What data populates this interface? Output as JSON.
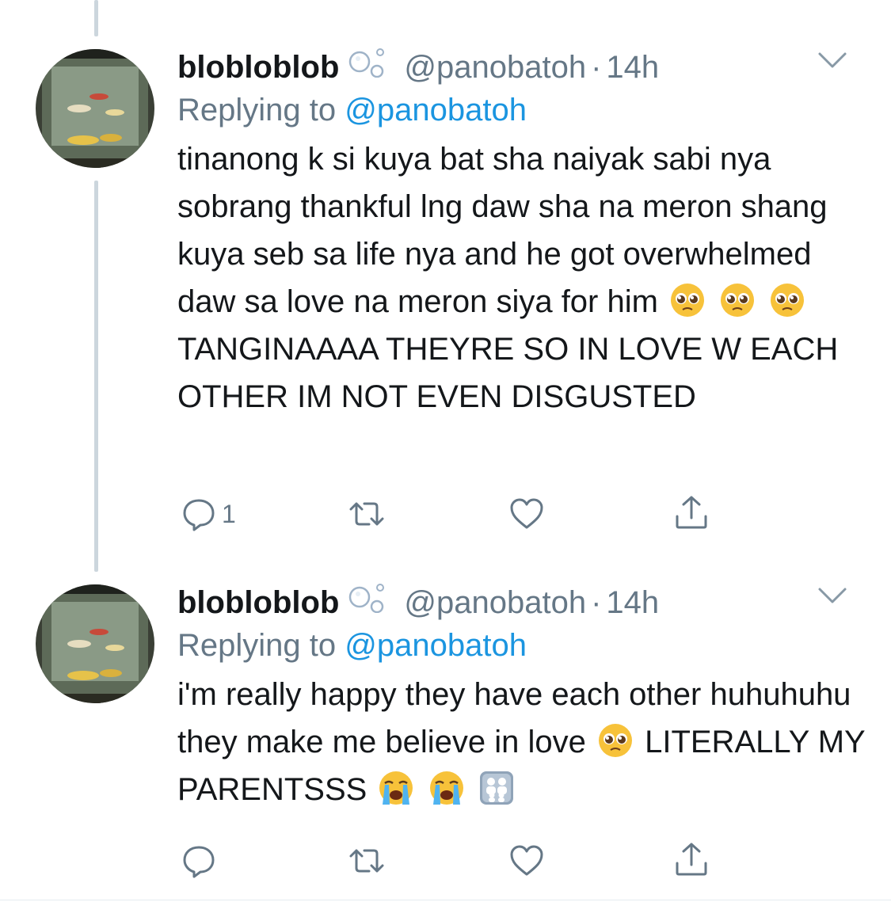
{
  "tweets": [
    {
      "name": "blobloblob",
      "handle": "@panobatoh",
      "separator": "·",
      "time": "14h",
      "replying_prefix": "Replying to",
      "replying_handle": "@panobatoh",
      "text_plain_1": "tinanong k si kuya bat sha naiyak sabi nya sobrang thankful lng daw sha na meron shang kuya seb sa life nya and he got overwhelmed daw sa love na meron siya for him",
      "text_plain_2": "TANGINAAAA THEYRE SO IN LOVE W EACH OTHER IM NOT EVEN DISGUSTED",
      "emojis": [
        "pleading-face",
        "pleading-face",
        "pleading-face"
      ],
      "reply_count": "1"
    },
    {
      "name": "blobloblob",
      "handle": "@panobatoh",
      "separator": "·",
      "time": "14h",
      "replying_prefix": "Replying to",
      "replying_handle": "@panobatoh",
      "text_plain_1": "i'm really happy they have each other huhuhuhu they make me believe in love",
      "text_plain_2": "LITERALLY MY PARENTSSS",
      "emojis": [
        "pleading-face",
        "loudly-crying-face",
        "loudly-crying-face",
        "family-icon"
      ],
      "reply_count": ""
    }
  ],
  "colors": {
    "text": "#14171a",
    "secondary": "#657786",
    "link": "#1b95e0",
    "thread_line": "#ccd6dd"
  }
}
